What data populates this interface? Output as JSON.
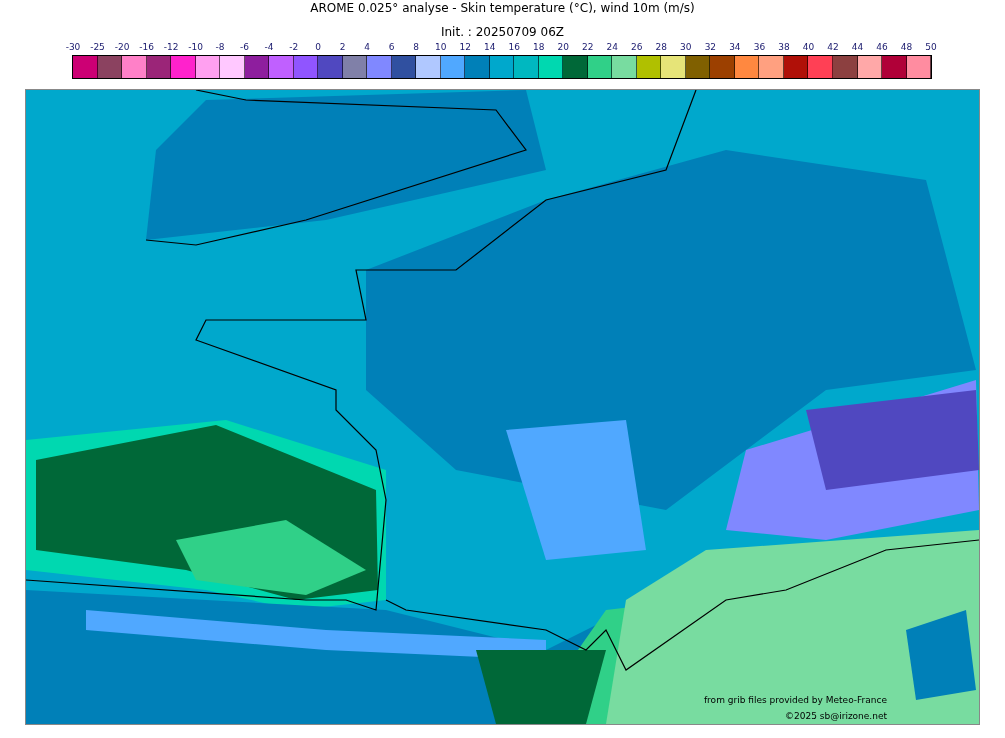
{
  "title": "AROME 0.025° analyse - Skin temperature (°C), wind 10m (m/s)",
  "subtitle": "Init. : 20250709 06Z",
  "colorbar": {
    "ticks": [
      "-30",
      "-25",
      "-20",
      "-16",
      "-12",
      "-10",
      "-8",
      "-6",
      "-4",
      "-2",
      "0",
      "2",
      "4",
      "6",
      "8",
      "10",
      "12",
      "14",
      "16",
      "18",
      "20",
      "22",
      "24",
      "26",
      "28",
      "30",
      "32",
      "34",
      "36",
      "38",
      "40",
      "42",
      "44",
      "46",
      "48",
      "50"
    ],
    "swatches": [
      {
        "color": "#cc0074"
      },
      {
        "color": "#8b4260"
      },
      {
        "color": "#ff80c8"
      },
      {
        "color": "#9b2578"
      },
      {
        "color": "#ff22cc"
      },
      {
        "color": "#ffa0f0"
      },
      {
        "color": "#ffc8ff"
      },
      {
        "color": "#8e1e9e"
      },
      {
        "color": "#c060ff"
      },
      {
        "color": "#9055ff"
      },
      {
        "color": "#5048c0"
      },
      {
        "color": "#8080a8"
      },
      {
        "color": "#8088ff"
      },
      {
        "color": "#3050a0"
      },
      {
        "color": "#b0c8ff"
      },
      {
        "color": "#50a8ff"
      },
      {
        "color": "#0080b8"
      },
      {
        "color": "#00a8cc"
      },
      {
        "color": "#00b8c0"
      },
      {
        "color": "#00d8b0"
      },
      {
        "color": "#006838"
      },
      {
        "color": "#30d088"
      },
      {
        "color": "#78dca0"
      },
      {
        "color": "#b0c000"
      },
      {
        "color": "#e6e478"
      },
      {
        "color": "#806000"
      },
      {
        "color": "#9c4000"
      },
      {
        "color": "#ff8840"
      },
      {
        "color": "#ffa080"
      },
      {
        "color": "#b01008"
      },
      {
        "color": "#ff4055"
      },
      {
        "color": "#8c4040"
      },
      {
        "color": "#ffa8a8"
      },
      {
        "color": "#b00038"
      },
      {
        "color": "#ff8ca0"
      }
    ]
  },
  "map": {
    "source_note": "from grib files provided by Meteo-France",
    "copyright": "©2025 sb@irizone.net"
  }
}
